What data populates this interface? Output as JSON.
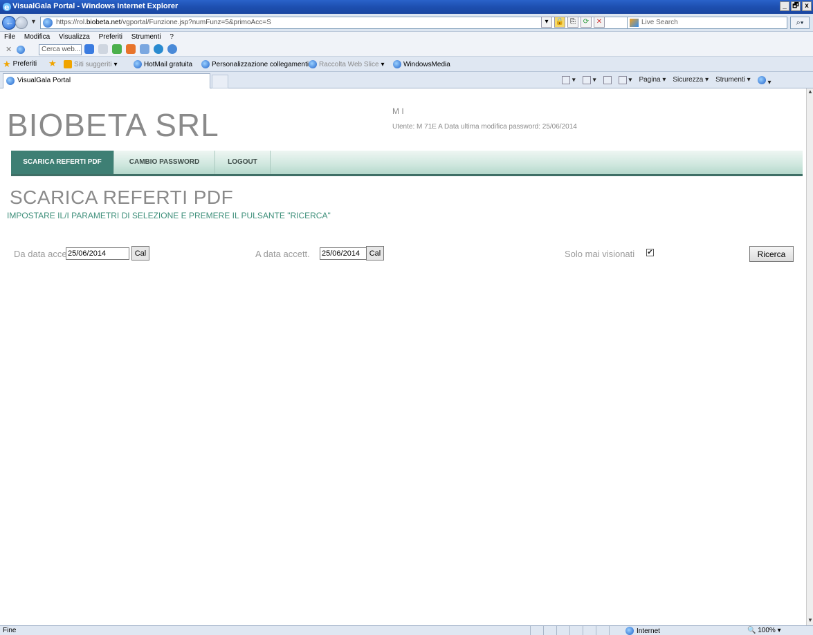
{
  "window": {
    "title": "VisualGala Portal - Windows Internet Explorer",
    "minimize": "_",
    "restore": "🗗",
    "close": "x"
  },
  "address": {
    "url_prefix": "https://rol.",
    "url_domain": "biobeta.net",
    "url_rest": "/vgportal/Funzione.jsp?numFunz=5&primoAcc=S",
    "live_search_placeholder": "Live Search"
  },
  "menu": {
    "items": [
      "File",
      "Modifica",
      "Visualizza",
      "Preferiti",
      "Strumenti",
      "?"
    ],
    "cerca_placeholder": "Cerca web..."
  },
  "favorites": {
    "preferiti": "Preferiti",
    "siti_suggeriti": "Siti suggeriti",
    "hotmail": "HotMail gratuita",
    "personalizzazione": "Personalizzazione collegamenti",
    "raccolta": "Raccolta Web Slice",
    "windowsmedia": "WindowsMedia"
  },
  "tab": {
    "label": "VisualGala Portal"
  },
  "commandbar": {
    "pagina": "Pagina",
    "sicurezza": "Sicurezza",
    "strumenti": "Strumenti"
  },
  "page": {
    "brand": "BIOBETA SRL",
    "user_line1": "M     I",
    "user_line2": "Utente: M          71E    A   Data ultima modifica password: 25/06/2014",
    "nav": [
      {
        "label": "SCARICA REFERTI PDF"
      },
      {
        "label": "CAMBIO PASSWORD"
      },
      {
        "label": "LOGOUT"
      }
    ],
    "title": "SCARICA REFERTI PDF",
    "subtitle": "IMPOSTARE IL/I PARAMETRI DI SELEZIONE E PREMERE IL PULSANTE \"RICERCA\"",
    "form": {
      "da_label": "Da data accett.",
      "da_value": "25/06/2014",
      "a_label": "A data accett.",
      "a_value": "25/06/2014",
      "cal_label": "Cal",
      "solo_label": "Solo mai visionati",
      "solo_checked": "✔",
      "ricerca_label": "Ricerca"
    }
  },
  "status": {
    "text": "Fine",
    "zone": "Internet",
    "zoom": "100%"
  }
}
